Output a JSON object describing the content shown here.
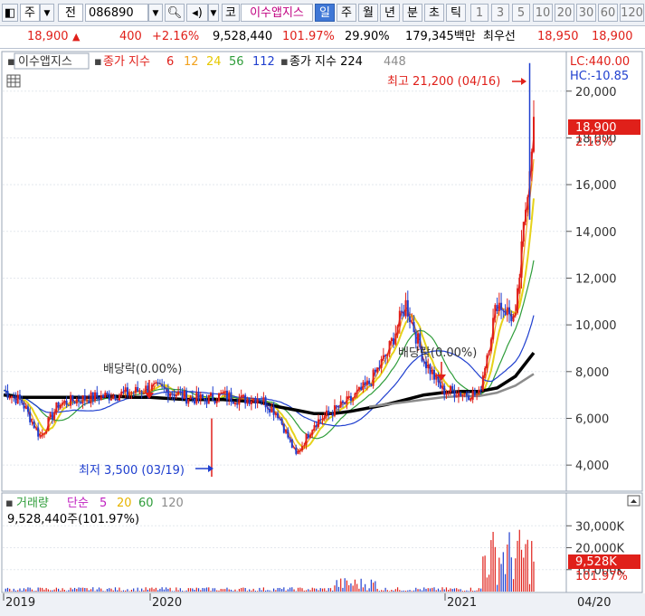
{
  "toolbar": {
    "market_label": "주",
    "prev_label": "전",
    "code": "086890",
    "search_icon": "magnifier-icon",
    "speaker_icon": "speaker-icon",
    "kosdaq_badge": "코",
    "stock_name": "이수앱지스",
    "periods": [
      "일",
      "주",
      "월",
      "년",
      "분",
      "초",
      "틱"
    ],
    "active_period": "일",
    "intervals": [
      "1",
      "3",
      "5",
      "10",
      "20",
      "30",
      "60",
      "120"
    ]
  },
  "quote": {
    "price": "18,900",
    "change": "400",
    "change_pct": "+2.16%",
    "volume": "9,528,440",
    "volume_ratio": "101.97%",
    "turnover": "29.90%",
    "amount": "179,345백만",
    "best_ask_label": "최우선",
    "ask": "18,950",
    "bid": "18,900"
  },
  "price_panel": {
    "legend_name": "이수앱지스",
    "ma_label": "종가 지수",
    "ma_periods": [
      "6",
      "12",
      "24",
      "56",
      "112"
    ],
    "ma_colors": [
      "#e0201a",
      "#f2a21e",
      "#e6d21a",
      "#2f9d3a",
      "#1f3fcf"
    ],
    "long_ma_label": "종가 지수 224",
    "long_ma_extra": "448",
    "long_ma_colors": [
      "#000000",
      "#8c8c8c"
    ],
    "lc_label": "LC:440.00",
    "hc_label": "HC:-10.85",
    "high_annotation": "최고 21,200 (04/16)",
    "low_annotation": "최저 3,500 (03/19)",
    "dividend_annotations": [
      "배당락(0.00%)",
      "배당락(0.00%)"
    ],
    "current_price_tag": "18,900",
    "current_pct_tag": "2.16%",
    "y_ticks": [
      "20,000",
      "18,000",
      "16,000",
      "14,000",
      "12,000",
      "10,000",
      "8,000",
      "6,000",
      "4,000"
    ]
  },
  "volume_panel": {
    "legend_name": "거래량",
    "ma_label": "단순",
    "ma_periods": [
      "5",
      "20",
      "60",
      "120"
    ],
    "ma_colors": [
      "#c020c0",
      "#e6b400",
      "#2f9d3a",
      "#8c8c8c"
    ],
    "value_line": "9,528,440주(101.97%)",
    "y_ticks": [
      "30,000K",
      "20,000K",
      "10,000K"
    ],
    "current_tag": "9,528K",
    "current_pct_tag": "101.97%"
  },
  "x_axis": {
    "labels": [
      "2019",
      "2020",
      "2021"
    ],
    "current_date": "04/20"
  },
  "chart_data": {
    "type": "candlestick",
    "ylim": [
      3000,
      21500
    ],
    "volume_ylim": [
      0,
      33000
    ],
    "x_labels": [
      "2019",
      "2020",
      "2021",
      "04/20"
    ],
    "series": [
      {
        "name": "종가",
        "x": [
          "2018-11",
          "2018-12",
          "2019-01",
          "2019-02",
          "2019-03",
          "2019-04",
          "2019-05",
          "2019-06",
          "2019-07",
          "2019-08",
          "2019-09",
          "2019-10",
          "2019-11",
          "2019-12",
          "2020-01",
          "2020-02",
          "2020-03",
          "2020-04",
          "2020-05",
          "2020-06",
          "2020-07",
          "2020-08",
          "2020-09",
          "2020-10",
          "2020-11",
          "2020-12",
          "2021-01",
          "2021-02",
          "2021-03",
          "2021-04"
        ],
        "values": [
          7200,
          6700,
          5200,
          6600,
          6800,
          6900,
          7000,
          7100,
          7300,
          7200,
          6900,
          6800,
          7000,
          6800,
          6900,
          6200,
          4400,
          5800,
          6300,
          6800,
          7500,
          8800,
          10900,
          8500,
          7200,
          7100,
          7000,
          11000,
          10200,
          18900
        ]
      },
      {
        "name": "224",
        "values": [
          7000,
          6900,
          6900,
          6900,
          6900,
          6900,
          6950,
          6900,
          6900,
          6850,
          6800,
          6800,
          6800,
          6750,
          6700,
          6500,
          6350,
          6200,
          6200,
          6300,
          6450,
          6600,
          6800,
          7000,
          7100,
          7150,
          7150,
          7300,
          7800,
          8800
        ]
      },
      {
        "name": "448",
        "values": [
          null,
          null,
          null,
          null,
          null,
          null,
          null,
          null,
          null,
          null,
          null,
          null,
          null,
          null,
          null,
          null,
          null,
          null,
          null,
          null,
          6500,
          6600,
          6700,
          6800,
          6900,
          6950,
          6950,
          7100,
          7400,
          7900
        ]
      }
    ],
    "extremes": {
      "high": 21200,
      "high_date": "04/16",
      "low": 3500,
      "low_date": "03/19"
    },
    "last": {
      "close": 18900,
      "change": 400,
      "change_pct": 2.16,
      "volume": 9528440
    }
  }
}
